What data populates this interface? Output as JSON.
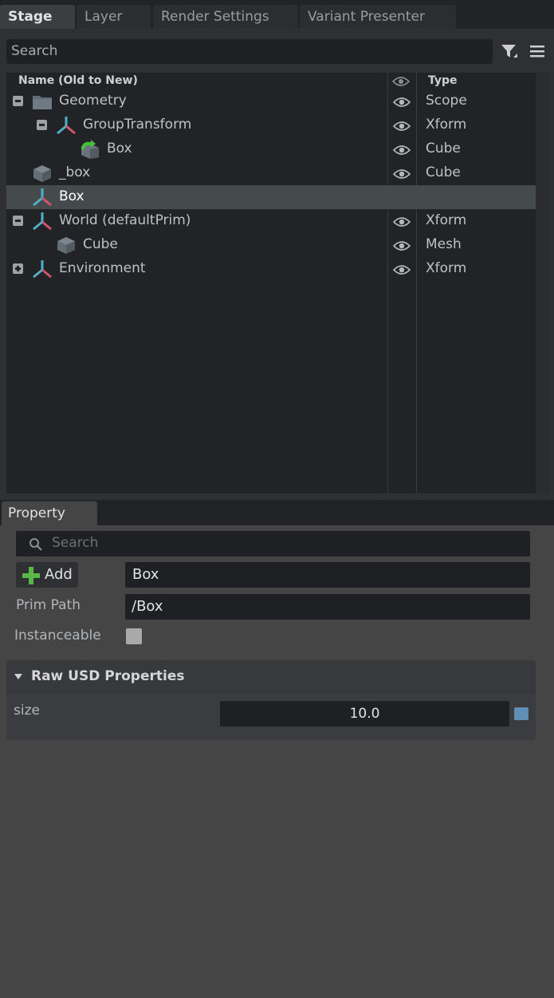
{
  "tabs": {
    "stage": "Stage",
    "layer": "Layer",
    "render_settings": "Render Settings",
    "variant_presenter": "Variant Presenter"
  },
  "stage": {
    "search_placeholder": "Search",
    "columns": {
      "name": "Name (Old to New)",
      "type": "Type"
    },
    "rows": [
      {
        "label": "Geometry",
        "type": "Scope",
        "icon": "folder-icon",
        "expander": "minus"
      },
      {
        "label": "GroupTransform",
        "type": "Xform",
        "icon": "xform-icon",
        "expander": "minus"
      },
      {
        "label": "Box",
        "type": "Cube",
        "icon": "instance-cube-icon",
        "expander": "none"
      },
      {
        "label": "_box",
        "type": "Cube",
        "icon": "cube-icon",
        "expander": "none"
      },
      {
        "label": "Box",
        "type": "",
        "icon": "xform-icon",
        "expander": "none",
        "selected": true
      },
      {
        "label": "World (defaultPrim)",
        "type": "Xform",
        "icon": "xform-icon",
        "expander": "minus"
      },
      {
        "label": "Cube",
        "type": "Mesh",
        "icon": "mesh-icon",
        "expander": "none"
      },
      {
        "label": "Environment",
        "type": "Xform",
        "icon": "xform-icon",
        "expander": "plus"
      }
    ]
  },
  "property": {
    "tab_label": "Property",
    "search_placeholder": "Search",
    "add_label": "Add",
    "name_value": "Box",
    "prim_path_label": "Prim Path",
    "prim_path_value": "/Box",
    "instanceable_label": "Instanceable",
    "instanceable_checked": false,
    "raw_usd_title": "Raw USD Properties",
    "size_label": "size",
    "size_value": "10.0"
  },
  "colors": {
    "panel_bg": "#454545",
    "tree_bg": "#222326",
    "selected_row": "#454a4d",
    "size_indicator": "#5f8fb5"
  }
}
